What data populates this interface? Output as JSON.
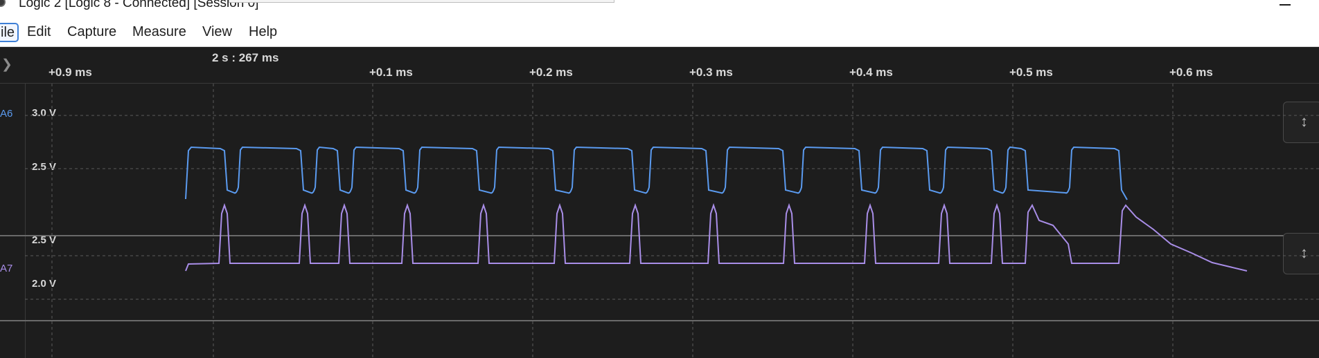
{
  "window": {
    "title": "Logic 2 [Logic 8 - Connected] [Session 0]"
  },
  "menu": [
    {
      "key": "file",
      "label": "ile"
    },
    {
      "key": "edit",
      "label": "Edit"
    },
    {
      "key": "capture",
      "label": "Capture"
    },
    {
      "key": "measure",
      "label": "Measure"
    },
    {
      "key": "view",
      "label": "View"
    },
    {
      "key": "help",
      "label": "Help"
    }
  ],
  "timeline": {
    "marker_label": "2 s : 267 ms",
    "ticks": [
      "+0.9 ms",
      "+0.1 ms",
      "+0.2 ms",
      "+0.3 ms",
      "+0.4 ms",
      "+0.5 ms",
      "+0.6 ms"
    ]
  },
  "channels": [
    {
      "name": "A6",
      "color": "#5b9bf0",
      "y_labels": [
        "3.0 V",
        "2.5 V"
      ]
    },
    {
      "name": "A7",
      "color": "#a98ee8",
      "y_labels": [
        "2.5 V",
        "2.0 V"
      ]
    }
  ],
  "icons": {
    "expand": "chevron-right-icon",
    "fit": "vertical-fit-icon"
  },
  "colors": {
    "background": "#1d1d1d",
    "grid": "#5a5a5a",
    "a6_trace": "#5b9bf0",
    "a7_trace": "#a98ee8"
  }
}
